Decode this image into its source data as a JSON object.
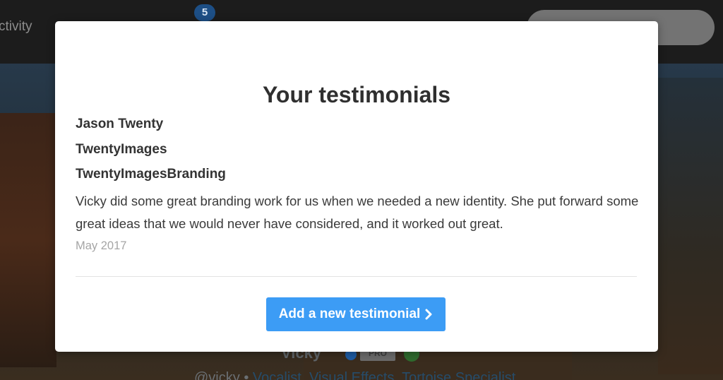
{
  "background": {
    "nav": {
      "activity_label": "ctivity",
      "notification_count": "5"
    },
    "profile": {
      "name": "Vicky",
      "pro_badge": "PRO",
      "handle": "@vicky",
      "separator": "•",
      "skills": [
        "Vocalist,",
        "Visual Effects,",
        "Tortoise Specialist"
      ]
    }
  },
  "modal": {
    "title": "Your testimonials",
    "testimonial": {
      "author": "Jason Twenty",
      "company": "TwentyImages",
      "project": "TwentyImagesBranding",
      "body": "Vicky did some great branding work for us when we needed a new identity. She put forward some great ideas that we would never have considered, and it worked out great.",
      "date": "May 2017"
    },
    "add_button_label": "Add a new testimonial"
  },
  "colors": {
    "accent": "#3c9cf5",
    "modal_bg": "#ffffff",
    "date_text": "#a5a5a5"
  }
}
